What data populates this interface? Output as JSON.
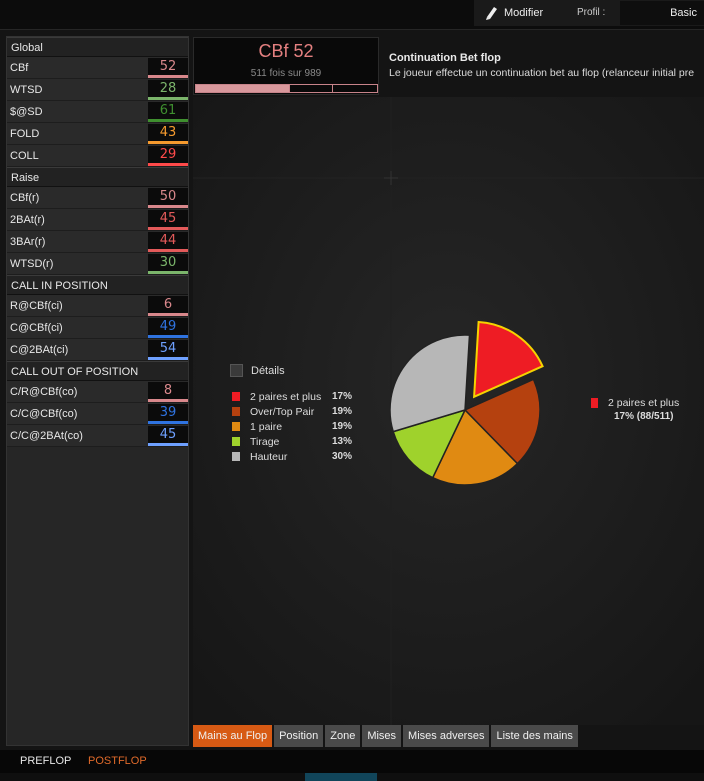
{
  "toolbar": {
    "modify_label": "Modifier",
    "profile_label": "Profil :",
    "profile_value": "Basic"
  },
  "sidebar": {
    "sections": [
      {
        "title": "Global",
        "stats": [
          {
            "label": "CBf",
            "value": "52",
            "color": "#d9888c"
          },
          {
            "label": "WTSD",
            "value": "28",
            "color": "#7bb56b"
          },
          {
            "label": "$@SD",
            "value": "61",
            "color": "#3f8f2f"
          },
          {
            "label": "FOLD",
            "value": "43",
            "color": "#f59a2e"
          },
          {
            "label": "COLL",
            "value": "29",
            "color": "#ff4a4a"
          }
        ]
      },
      {
        "title": "Raise",
        "stats": [
          {
            "label": "CBf(r)",
            "value": "50",
            "color": "#d9888c"
          },
          {
            "label": "2BAt(r)",
            "value": "45",
            "color": "#e35a5a"
          },
          {
            "label": "3BAr(r)",
            "value": "44",
            "color": "#e35a5a"
          },
          {
            "label": "WTSD(r)",
            "value": "30",
            "color": "#7bb56b"
          }
        ]
      },
      {
        "title": "CALL IN POSITION",
        "stats": [
          {
            "label": "R@CBf(ci)",
            "value": "6",
            "color": "#d9888c"
          },
          {
            "label": "C@CBf(ci)",
            "value": "49",
            "color": "#2f73e0"
          },
          {
            "label": "C@2BAt(ci)",
            "value": "54",
            "color": "#6ea0ff"
          }
        ]
      },
      {
        "title": "CALL OUT OF POSITION",
        "stats": [
          {
            "label": "C/R@CBf(co)",
            "value": "8",
            "color": "#d9888c"
          },
          {
            "label": "C/C@CBf(co)",
            "value": "39",
            "color": "#2f73e0"
          },
          {
            "label": "C/C@2BAt(co)",
            "value": "45",
            "color": "#6ea0ff"
          }
        ]
      }
    ]
  },
  "header": {
    "stat_title": "CBf 52",
    "stat_sub": "511 fois sur 989",
    "stat_fraction": 0.52,
    "desc_title": "Continuation Bet flop",
    "desc_text": "Le joueur effectue un continuation bet au flop (relanceur initial pre"
  },
  "chart": {
    "details_label": "Détails",
    "legend": [
      {
        "name": "2 paires et plus",
        "pct": "17%",
        "color": "#ee1c24"
      },
      {
        "name": "Over/Top Pair",
        "pct": "19%",
        "color": "#b5410f"
      },
      {
        "name": "1 paire",
        "pct": "19%",
        "color": "#e08a12"
      },
      {
        "name": "Tirage",
        "pct": "13%",
        "color": "#9fd22c"
      },
      {
        "name": "Hauteur",
        "pct": "30%",
        "color": "#b7b7b7"
      }
    ],
    "callout_name": "2 paires et plus",
    "callout_value": "17% (88/511)"
  },
  "chart_data": {
    "type": "pie",
    "categories": [
      "2 paires et plus",
      "Over/Top Pair",
      "1 paire",
      "Tirage",
      "Hauteur"
    ],
    "values": [
      17,
      19,
      19,
      13,
      30
    ],
    "colors": [
      "#ee1c24",
      "#b5410f",
      "#e08a12",
      "#9fd22c",
      "#b7b7b7"
    ],
    "exploded": "2 paires et plus"
  },
  "tabs": [
    {
      "label": "Mains au Flop",
      "active": true
    },
    {
      "label": "Position",
      "active": false
    },
    {
      "label": "Zone",
      "active": false
    },
    {
      "label": "Mises",
      "active": false
    },
    {
      "label": "Mises adverses",
      "active": false
    },
    {
      "label": "Liste des mains",
      "active": false
    }
  ],
  "footer": {
    "preflop": "PREFLOP",
    "postflop": "POSTFLOP"
  }
}
